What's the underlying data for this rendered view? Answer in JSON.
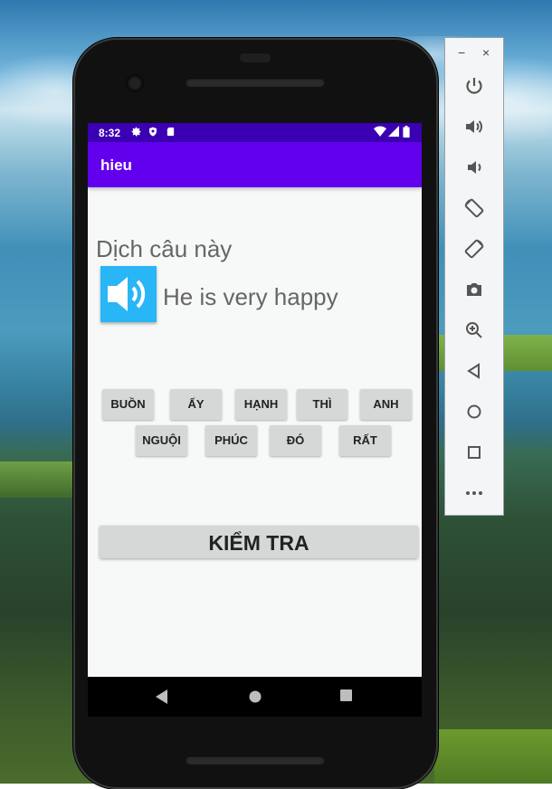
{
  "status_bar": {
    "time": "8:32",
    "left_icons": [
      "gear-icon",
      "shield-icon",
      "sd-card-icon"
    ],
    "right_icons": [
      "wifi-icon",
      "signal-icon",
      "battery-icon"
    ]
  },
  "app_bar": {
    "title": "hieu"
  },
  "exercise": {
    "instruction": "Dịch câu này",
    "sentence": "He is very happy",
    "speaker_icon": "speaker-icon"
  },
  "word_bank": {
    "row1": [
      "BUỒN",
      "ẤY",
      "HẠNH",
      "THÌ",
      "ANH"
    ],
    "row2": [
      "NGUỘI",
      "PHÚC",
      "ĐÓ",
      "RẤT"
    ]
  },
  "check_button": {
    "label": "KIỂM TRA"
  },
  "nav_bar": [
    "back-icon",
    "home-icon",
    "recents-icon"
  ],
  "emulator_toolbar": {
    "window_controls": [
      "−",
      "×"
    ],
    "tools": [
      "power-icon",
      "volume-up-icon",
      "volume-down-icon",
      "rotate-left-icon",
      "rotate-right-icon",
      "camera-icon",
      "zoom-icon",
      "back-icon",
      "home-icon",
      "overview-icon",
      "more-icon"
    ]
  },
  "colors": {
    "status_bar": "#3b00b3",
    "app_bar": "#6200ee",
    "speaker_button": "#29b6f6",
    "word_tile": "#d6d7d7"
  }
}
